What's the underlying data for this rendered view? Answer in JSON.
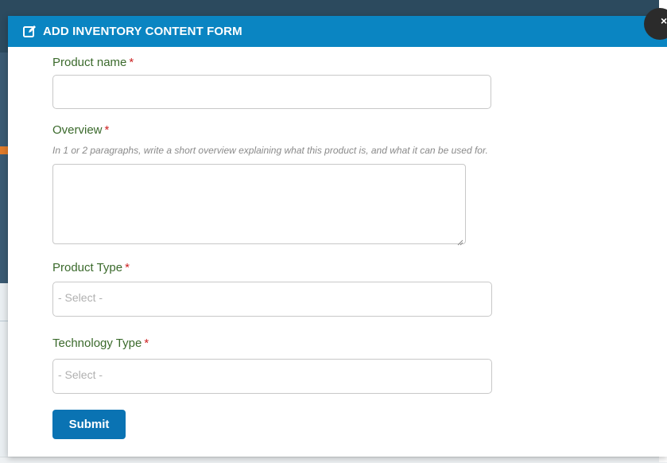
{
  "modal": {
    "title": "ADD INVENTORY CONTENT FORM",
    "header_icon": "edit-icon",
    "close_icon": "close-icon",
    "close_glyph": "×"
  },
  "form": {
    "required_marker": "*",
    "product_name": {
      "label": "Product name",
      "value": ""
    },
    "overview": {
      "label": "Overview",
      "helper": "In 1 or 2 paragraphs, write a short overview explaining what this product is, and what it can be used for.",
      "value": ""
    },
    "product_type": {
      "label": "Product Type",
      "selected": "- Select -"
    },
    "technology_type": {
      "label": "Technology Type",
      "selected": "- Select -"
    },
    "submit_label": "Submit"
  },
  "colors": {
    "header": "#0a85c2",
    "label": "#3b6a2c",
    "required": "#cc2222",
    "submit": "#0a73b3"
  }
}
